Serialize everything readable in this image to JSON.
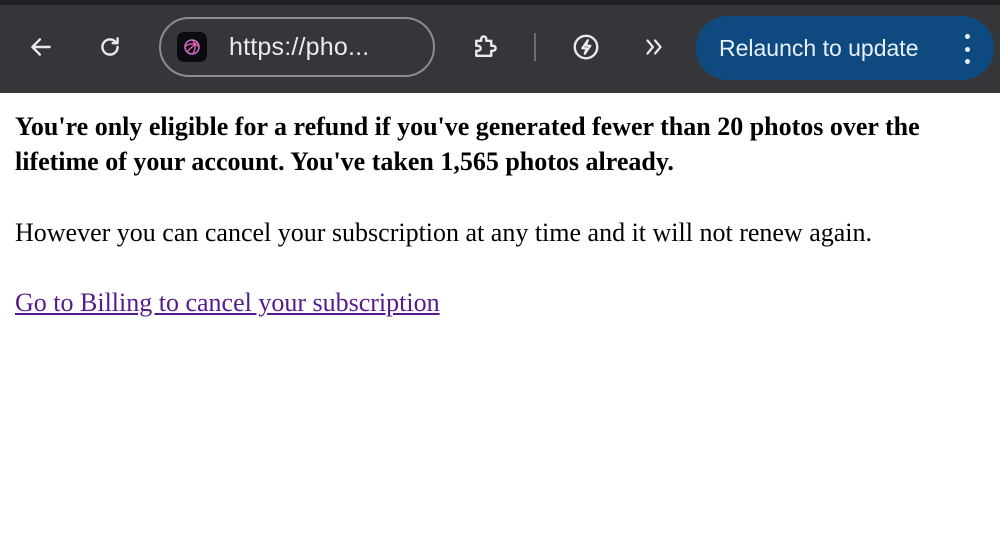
{
  "browser": {
    "url_display": "https://pho...",
    "relaunch_label": "Relaunch to update",
    "colors": {
      "toolbar_bg": "#35363a",
      "relaunch_bg": "#0e4a7f",
      "icon": "#e8eaed"
    },
    "icons": [
      "back-arrow-icon",
      "reload-icon",
      "site-favicon-icon",
      "extensions-puzzle-icon",
      "bolt-icon",
      "chevron-double-right-icon",
      "kebab-menu-icon"
    ]
  },
  "page": {
    "heading": "You're only eligible for a refund if you've generated fewer than 20 photos over the lifetime of your account. You've taken 1,565 photos already.",
    "paragraph": "However you can cancel your subscription at any time and it will not renew again.",
    "link_text": "Go to Billing to cancel your subscription",
    "colors": {
      "link": "#551a8b",
      "text": "#000000"
    }
  }
}
